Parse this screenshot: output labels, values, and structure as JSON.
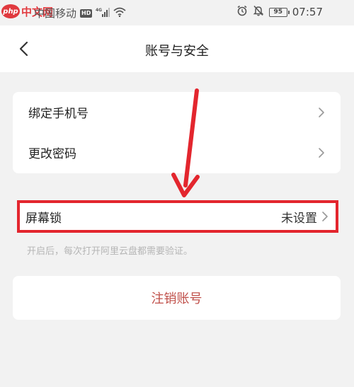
{
  "watermark": {
    "logo_text": "php",
    "site_text": "中文网"
  },
  "status_bar": {
    "carrier": "中国移动",
    "hd_label": "HD",
    "network_type": "4G",
    "battery_level": "95",
    "time": "07:57"
  },
  "nav": {
    "title": "账号与安全"
  },
  "settings": {
    "items": [
      {
        "label": "绑定手机号"
      },
      {
        "label": "更改密码"
      }
    ],
    "screen_lock": {
      "label": "屏幕锁",
      "value": "未设置"
    },
    "hint": "开启后，每次打开阿里云盘都需要验证。"
  },
  "delete_account": {
    "label": "注销账号"
  },
  "colors": {
    "accent_red": "#e3262e",
    "delete_text": "#c0504a",
    "background": "#f2f2f2"
  }
}
